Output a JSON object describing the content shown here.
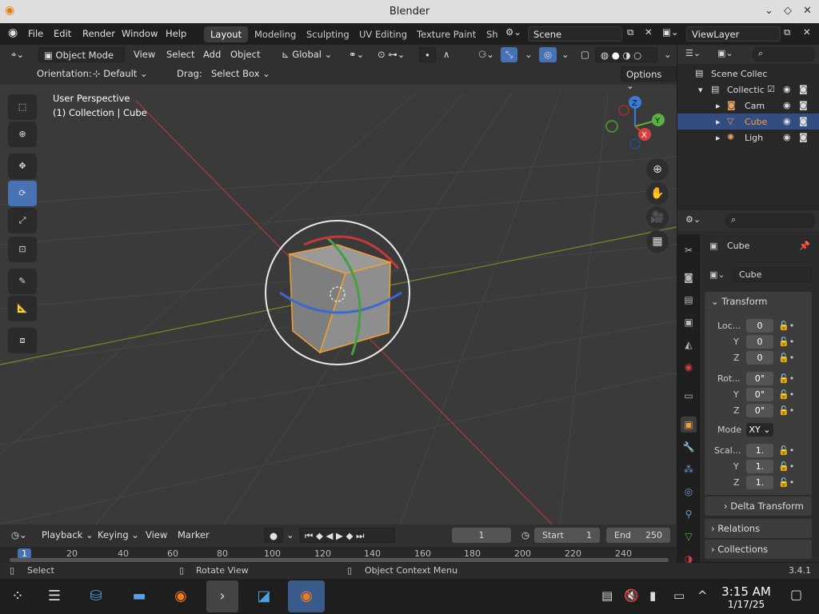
{
  "window": {
    "title": "Blender"
  },
  "topbar": {
    "menus": [
      "File",
      "Edit",
      "Render",
      "Window",
      "Help"
    ],
    "workspaces": [
      "Layout",
      "Modeling",
      "Sculpting",
      "UV Editing",
      "Texture Paint",
      "Sh"
    ],
    "scene": "Scene",
    "view_layer": "ViewLayer"
  },
  "viewport": {
    "mode": "Object Mode",
    "menus": [
      "View",
      "Select",
      "Add",
      "Object"
    ],
    "transform_orientation": "Global",
    "orientation_label": "Orientation:",
    "orientation_value": "Default",
    "drag_label": "Drag:",
    "drag_value": "Select Box",
    "options": "Options",
    "overlay_line1": "User Perspective",
    "overlay_line2": "(1) Collection | Cube",
    "gizmo": {
      "x": "X",
      "y": "Y",
      "z": "Z"
    }
  },
  "outliner": {
    "rows": [
      {
        "label": "Scene Collec"
      },
      {
        "label": "Collectic"
      },
      {
        "label": "Cam"
      },
      {
        "label": "Cube"
      },
      {
        "label": "Ligh"
      }
    ]
  },
  "properties": {
    "object_name": "Cube",
    "data_name": "Cube",
    "transform": "Transform",
    "location_label": "Loc...",
    "rotation_label": "Rot...",
    "scale_label": "Scal...",
    "mode_label": "Mode",
    "mode_value": "XY",
    "axes": [
      "Y",
      "Z"
    ],
    "location": [
      "0",
      "0",
      "0"
    ],
    "rotation": [
      "0°",
      "0°",
      "0°"
    ],
    "scale": [
      "1.",
      "1.",
      "1."
    ],
    "delta": "Delta Transform",
    "relations": "Relations",
    "collections": "Collections"
  },
  "timeline": {
    "menus": [
      "Playback",
      "Keying",
      "View",
      "Marker"
    ],
    "current_frame": "1",
    "start_label": "Start",
    "start": "1",
    "end_label": "End",
    "end": "250",
    "ticks": [
      "1",
      "20",
      "40",
      "60",
      "80",
      "100",
      "120",
      "140",
      "160",
      "180",
      "200",
      "220",
      "240"
    ]
  },
  "status": {
    "select": "Select",
    "rotate": "Rotate View",
    "context": "Object Context Menu",
    "version": "3.4.1"
  },
  "taskbar": {
    "time": "3:15 AM",
    "date": "1/17/25"
  }
}
